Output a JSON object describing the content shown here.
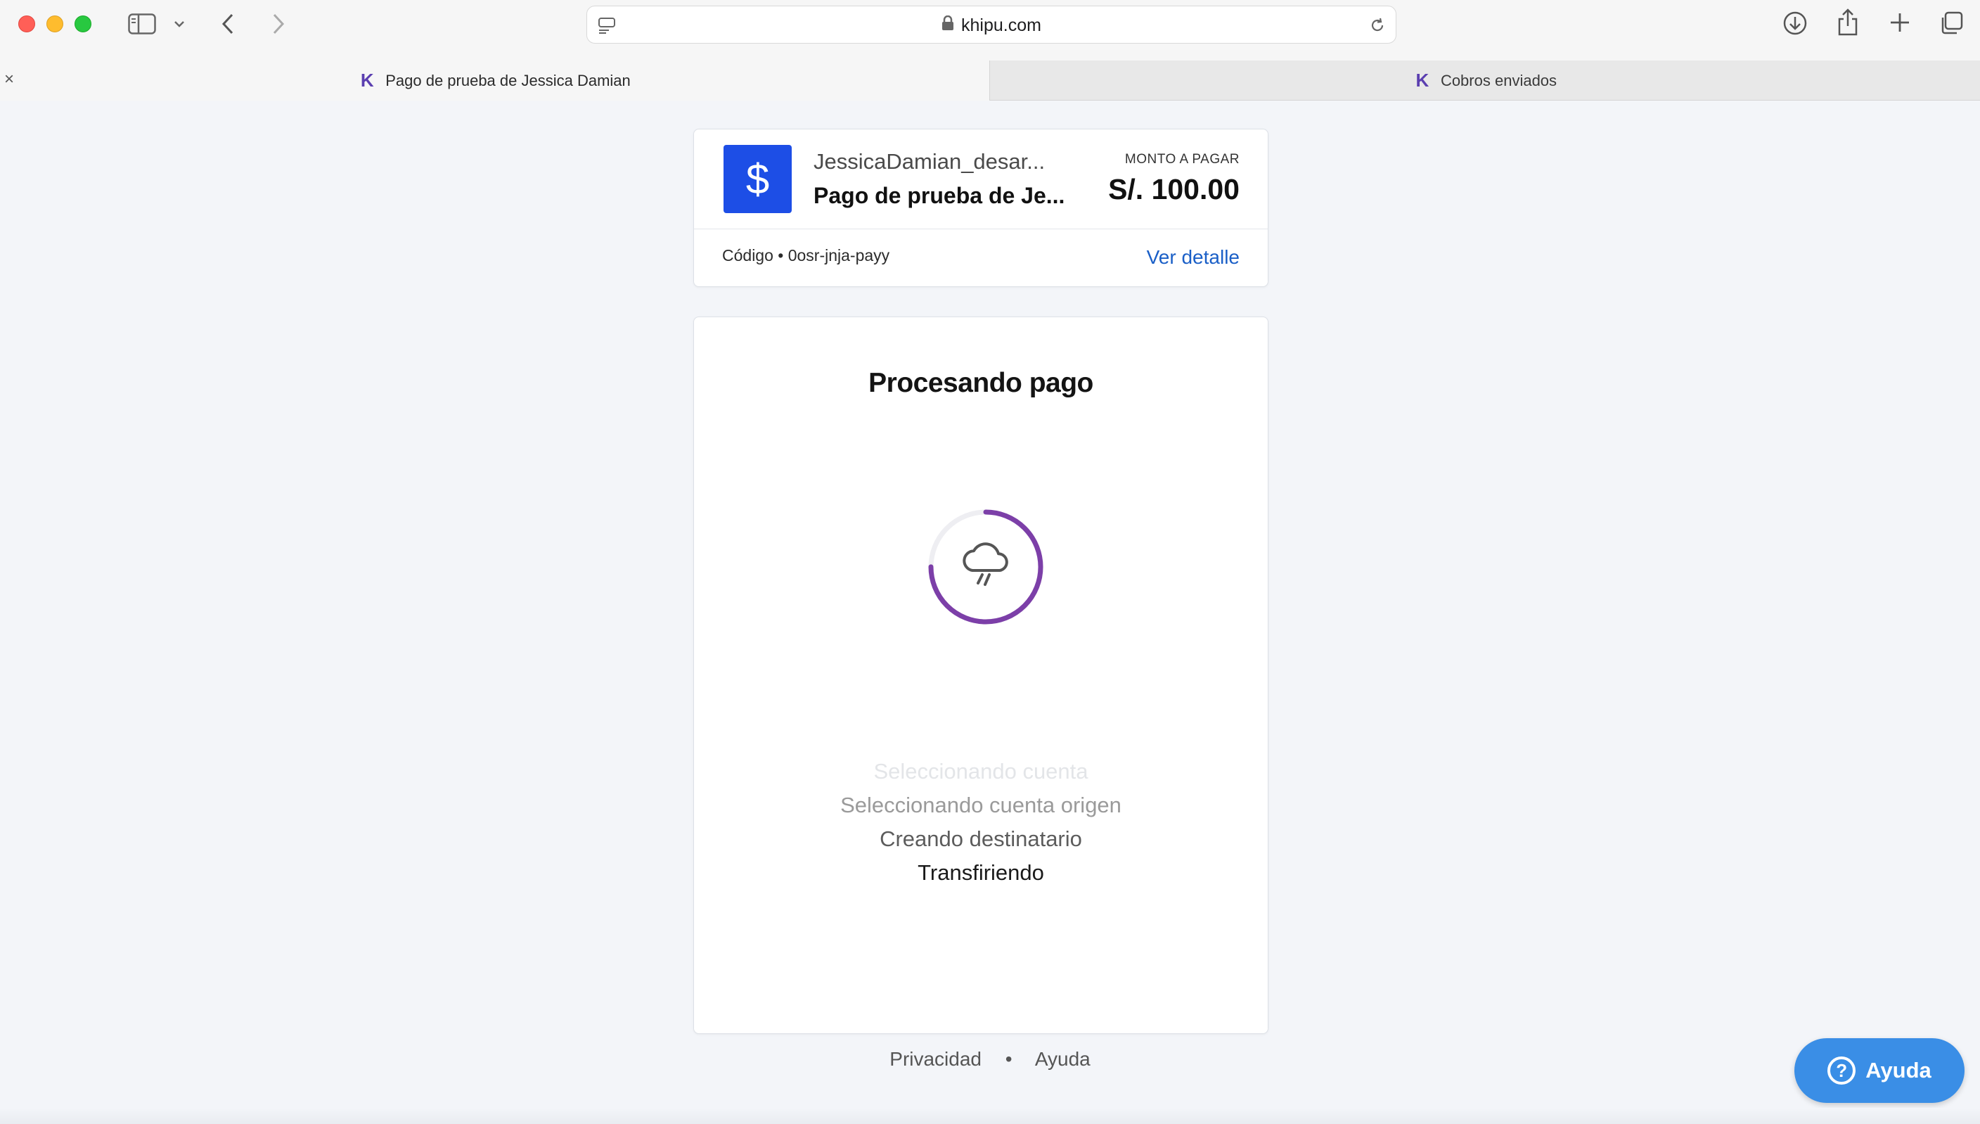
{
  "browser": {
    "url": "khipu.com",
    "tabs": [
      {
        "title": "Pago de prueba de Jessica Damian",
        "active": true
      },
      {
        "title": "Cobros enviados",
        "active": false
      }
    ]
  },
  "payment": {
    "merchant_name": "JessicaDamian_desar...",
    "subject": "Pago de prueba de Je...",
    "amount_label": "MONTO A PAGAR",
    "amount": "S/. 100.00",
    "code": "Código • 0osr-jnja-payy",
    "detail_link": "Ver detalle",
    "logo_symbol": "$"
  },
  "processing": {
    "title": "Procesando pago",
    "progress_fraction": 0.75,
    "steps": [
      {
        "label": "Seleccionando cuenta",
        "color": "#e3e5e8"
      },
      {
        "label": "Seleccionando cuenta origen",
        "color": "#9a9a9a"
      },
      {
        "label": "Creando destinatario",
        "color": "#5c5c5c"
      },
      {
        "label": "Transfiriendo",
        "color": "#1a1a1a"
      }
    ]
  },
  "footer": {
    "privacy": "Privacidad",
    "separator": "•",
    "help": "Ayuda"
  },
  "help_button": {
    "label": "Ayuda",
    "icon": "?"
  },
  "colors": {
    "brand_blue": "#1d4ee6",
    "link_blue": "#1a5fc7",
    "spinner_purple": "#7c3fa8",
    "help_button": "#3a8ee6"
  }
}
